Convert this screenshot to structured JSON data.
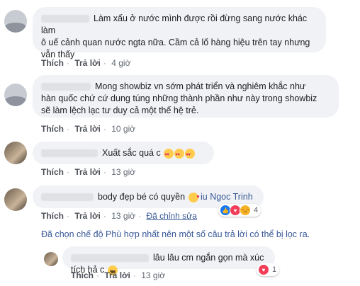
{
  "comments": [
    {
      "text": "Làm xấu ở nước mình được rồi đừng sang nước khác làm\nô uế cảnh quan nước ngta nữa. Cầm cả lố hàng hiệu trên tay nhưng\nvẫn thấy",
      "like": "Thích",
      "reply": "Trả lời",
      "time": "4 giờ"
    },
    {
      "text": "Mong showbiz vn sớm phát triển và nghiêm khắc như\nhàn quốc chứ cứ dung túng những thành phần như này trong showbiz\nsẽ làm lệch lạc tư duy cả một thế hệ trẻ.",
      "like": "Thích",
      "reply": "Trả lời",
      "time": "10 giờ"
    },
    {
      "text": "Xuất sắc quá c",
      "like": "Thích",
      "reply": "Trả lời",
      "time": "13 giờ"
    },
    {
      "text": "body đẹp bé có quyền",
      "mention": "iu Ngoc Trinh",
      "like": "Thích",
      "reply": "Trả lời",
      "time": "13 giờ",
      "edited": "Đã chỉnh sửa",
      "reaction_count": "4"
    }
  ],
  "filter_notice": "Đã chọn chế độ Phù hợp nhất nên một số câu trả lời có thể bị lọc ra.",
  "reply": {
    "text": "lâu lâu cm ngắn gọn mà xúc tích hả c",
    "like": "Thích",
    "reply": "Trả lời",
    "time": "13 giờ",
    "reaction_count": "1"
  },
  "separator": "·",
  "icons": {
    "like": "like-icon",
    "love": "love-icon",
    "haha": "haha-icon",
    "heart_eyes": "heart-eyes-emoji",
    "kiss": "kiss-emoji"
  }
}
